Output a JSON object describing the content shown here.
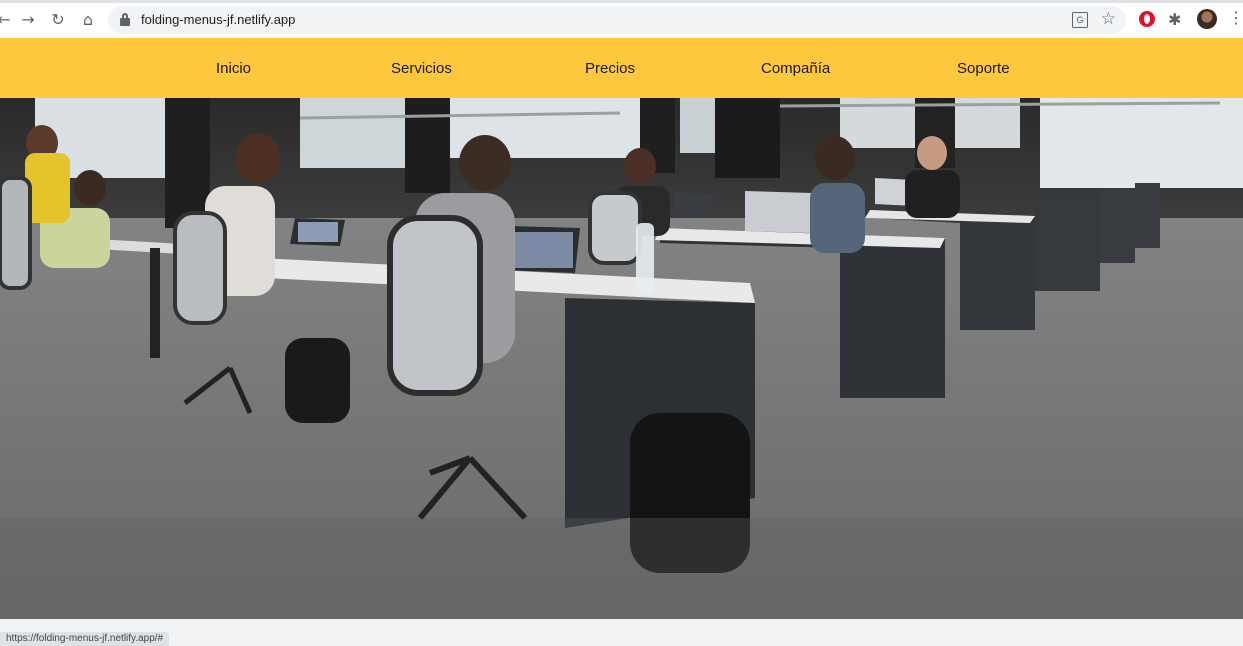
{
  "browser": {
    "url": "folding-menus-jf.netlify.app",
    "status_url": "https://folding-menus-jf.netlify.app/#",
    "icons": [
      "back-icon",
      "forward-icon",
      "reload-icon",
      "home-icon",
      "lock-icon",
      "translate-icon",
      "star-icon",
      "opera-icon",
      "extensions-icon",
      "profile-avatar",
      "menu-icon"
    ]
  },
  "nav": {
    "items": [
      "Inicio",
      "Servicios",
      "Precios",
      "Compañía",
      "Soporte"
    ],
    "background": "#fec83e"
  },
  "hero": {
    "description_icon": "office-photo"
  }
}
